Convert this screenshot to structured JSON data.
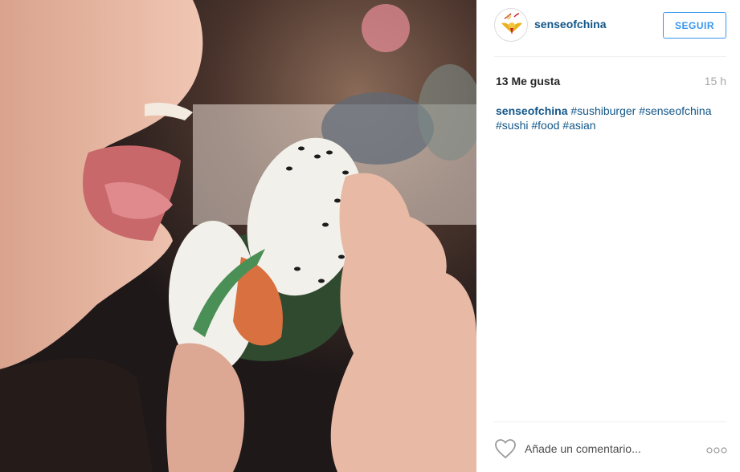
{
  "post": {
    "photo": {
      "colors": {
        "skin": "#e8b9a5",
        "skin_shadow": "#c98a74",
        "lip": "#c9686a",
        "rice": "#f2f0ea",
        "sesame": "#1c1c1c",
        "seaweed": "#2f4a2f",
        "salmon": "#d9703f",
        "background": "#3a2a26"
      }
    },
    "header": {
      "username": "senseofchina",
      "follow_label": "SEGUIR",
      "avatar_icon": "golden-bird-logo-icon"
    },
    "stats": {
      "likes": "13 Me gusta",
      "time_ago": "15 h"
    },
    "caption": {
      "user": "senseofchina",
      "hashtags": [
        "#sushiburger",
        "#senseofchina",
        "#sushi",
        "#food",
        "#asian"
      ]
    },
    "footer": {
      "comment_placeholder": "Añade un comentario...",
      "like_icon": "heart-outline-icon",
      "more_icon": "more-options-icon"
    },
    "colors": {
      "link": "#125688",
      "accent": "#3897f0",
      "muted": "#a5a7aa",
      "divider": "#efefef"
    }
  }
}
